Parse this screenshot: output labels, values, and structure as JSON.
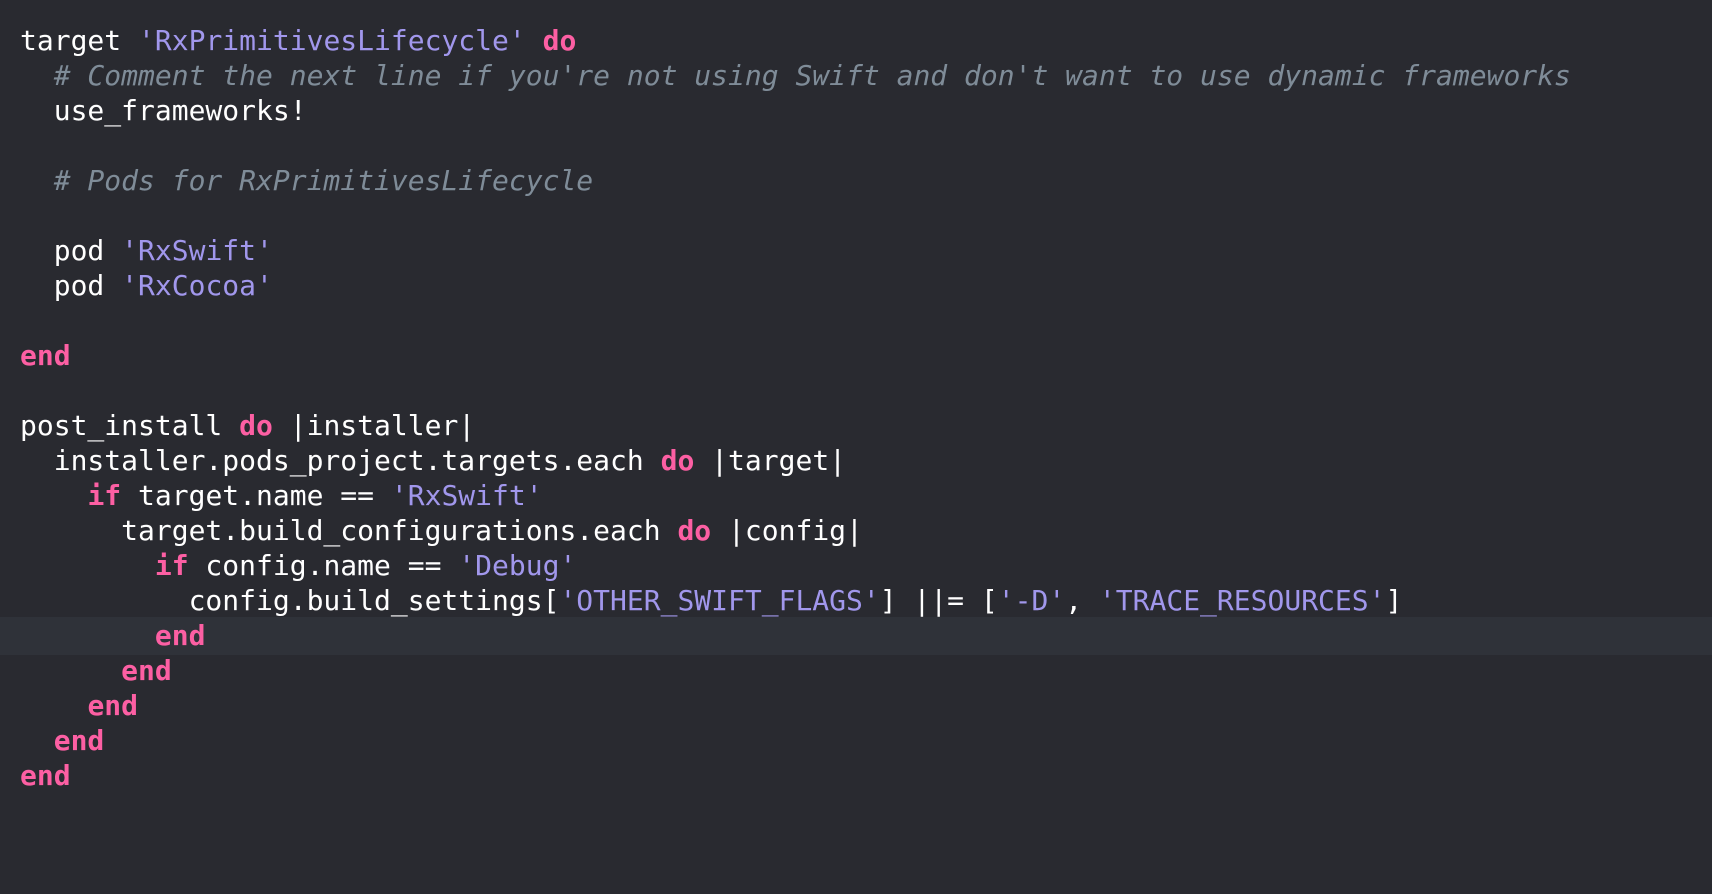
{
  "editor": {
    "current_line": 17,
    "colors": {
      "background": "#292a30",
      "current_line": "#2f3239",
      "keyword": "#fc5fa3",
      "string": "#a197ec",
      "comment": "#7f8c98",
      "plain": "#ffffff"
    },
    "lines": [
      [
        {
          "t": "kw-plain",
          "v": "target "
        },
        {
          "t": "str",
          "v": "'RxPrimitivesLifecycle'"
        },
        {
          "t": "pl",
          "v": " "
        },
        {
          "t": "kw",
          "v": "do"
        }
      ],
      [
        {
          "t": "cm",
          "v": "  # Comment the next line if you're not using Swift and don't want to use dynamic frameworks"
        }
      ],
      [
        {
          "t": "pl",
          "v": "  use_frameworks!"
        }
      ],
      [],
      [
        {
          "t": "cm",
          "v": "  # Pods for RxPrimitivesLifecycle"
        }
      ],
      [],
      [
        {
          "t": "pl",
          "v": "  pod "
        },
        {
          "t": "str",
          "v": "'RxSwift'"
        }
      ],
      [
        {
          "t": "pl",
          "v": "  pod "
        },
        {
          "t": "str",
          "v": "'RxCocoa'"
        }
      ],
      [],
      [
        {
          "t": "kw",
          "v": "end"
        }
      ],
      [],
      [
        {
          "t": "pl",
          "v": "post_install "
        },
        {
          "t": "kw",
          "v": "do"
        },
        {
          "t": "pl",
          "v": " |installer|"
        }
      ],
      [
        {
          "t": "pl",
          "v": "  installer.pods_project.targets.each "
        },
        {
          "t": "kw",
          "v": "do"
        },
        {
          "t": "pl",
          "v": " |target|"
        }
      ],
      [
        {
          "t": "pl",
          "v": "    "
        },
        {
          "t": "kw",
          "v": "if"
        },
        {
          "t": "pl",
          "v": " target.name == "
        },
        {
          "t": "str",
          "v": "'RxSwift'"
        }
      ],
      [
        {
          "t": "pl",
          "v": "      target.build_configurations.each "
        },
        {
          "t": "kw",
          "v": "do"
        },
        {
          "t": "pl",
          "v": " |config|"
        }
      ],
      [
        {
          "t": "pl",
          "v": "        "
        },
        {
          "t": "kw",
          "v": "if"
        },
        {
          "t": "pl",
          "v": " config.name == "
        },
        {
          "t": "str",
          "v": "'Debug'"
        }
      ],
      [
        {
          "t": "pl",
          "v": "          config.build_settings["
        },
        {
          "t": "str",
          "v": "'OTHER_SWIFT_FLAGS'"
        },
        {
          "t": "pl",
          "v": "] ||= ["
        },
        {
          "t": "str",
          "v": "'-D'"
        },
        {
          "t": "pl",
          "v": ", "
        },
        {
          "t": "str",
          "v": "'TRACE_RESOURCES'"
        },
        {
          "t": "pl",
          "v": "]"
        }
      ],
      [
        {
          "t": "pl",
          "v": "        "
        },
        {
          "t": "kw",
          "v": "end"
        }
      ],
      [
        {
          "t": "pl",
          "v": "      "
        },
        {
          "t": "kw",
          "v": "end"
        }
      ],
      [
        {
          "t": "pl",
          "v": "    "
        },
        {
          "t": "kw",
          "v": "end"
        }
      ],
      [
        {
          "t": "pl",
          "v": "  "
        },
        {
          "t": "kw",
          "v": "end"
        }
      ],
      [
        {
          "t": "kw",
          "v": "end"
        }
      ]
    ]
  }
}
